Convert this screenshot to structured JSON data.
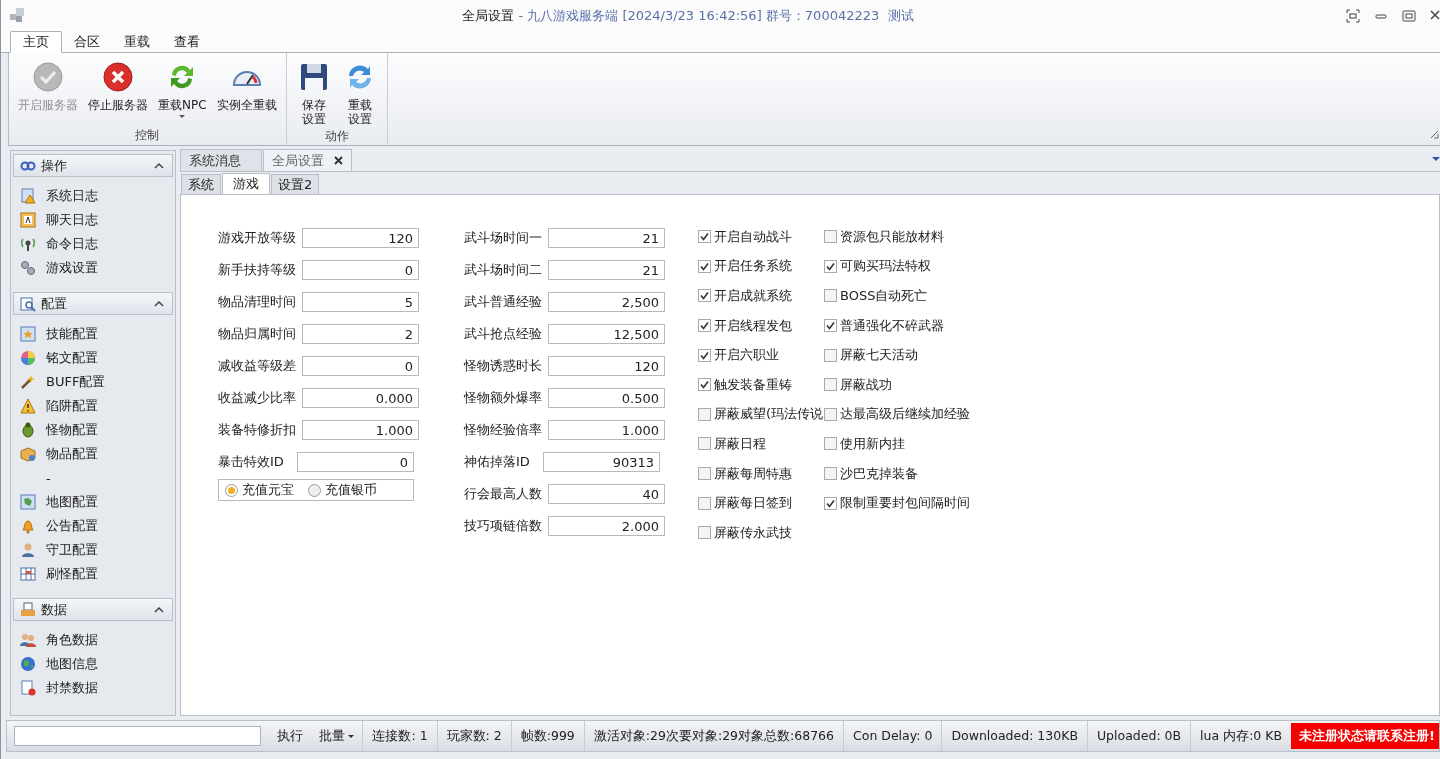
{
  "window": {
    "title": "全局设置",
    "subtitle": "- 九八游戏服务端 [2024/3/23 16:42:56] 群号：700042223  测试"
  },
  "ribbon": {
    "tabs": [
      {
        "label": "主页",
        "selected": true
      },
      {
        "label": "合区",
        "selected": false
      },
      {
        "label": "重载",
        "selected": false
      },
      {
        "label": "查看",
        "selected": false
      }
    ],
    "groups": [
      {
        "label": "控制",
        "buttons": [
          {
            "label": "开启服务器",
            "disabled": true,
            "dropdown": false
          },
          {
            "label": "停止服务器",
            "disabled": false,
            "dropdown": false
          },
          {
            "label": "重载NPC",
            "disabled": false,
            "dropdown": true
          },
          {
            "label": "实例全重载",
            "disabled": false,
            "dropdown": false
          }
        ]
      },
      {
        "label": "动作",
        "buttons": [
          {
            "label": "保存设置",
            "disabled": false,
            "dropdown": false
          },
          {
            "label": "重载设置",
            "disabled": false,
            "dropdown": false
          }
        ]
      }
    ]
  },
  "sidebar": {
    "sections": [
      {
        "title": "操作",
        "expanded": true,
        "items": [
          {
            "label": "系统日志",
            "kind": "item"
          },
          {
            "label": "聊天日志",
            "kind": "item"
          },
          {
            "label": "命令日志",
            "kind": "item"
          },
          {
            "label": "游戏设置",
            "kind": "item"
          }
        ]
      },
      {
        "title": "配置",
        "expanded": true,
        "items": [
          {
            "label": "技能配置",
            "kind": "item"
          },
          {
            "label": "铭文配置",
            "kind": "item"
          },
          {
            "label": "BUFF配置",
            "kind": "item"
          },
          {
            "label": "陷阱配置",
            "kind": "item"
          },
          {
            "label": "怪物配置",
            "kind": "item"
          },
          {
            "label": "物品配置",
            "kind": "item"
          },
          {
            "label": "-",
            "kind": "separator"
          },
          {
            "label": "地图配置",
            "kind": "item"
          },
          {
            "label": "公告配置",
            "kind": "item"
          },
          {
            "label": "守卫配置",
            "kind": "item"
          },
          {
            "label": "刷怪配置",
            "kind": "item"
          }
        ]
      },
      {
        "title": "数据",
        "expanded": true,
        "items": [
          {
            "label": "角色数据",
            "kind": "item"
          },
          {
            "label": "地图信息",
            "kind": "item"
          },
          {
            "label": "封禁数据",
            "kind": "item"
          }
        ]
      }
    ]
  },
  "doc_tabs": [
    {
      "label": "系统消息",
      "selected": false,
      "closable": false
    },
    {
      "label": "全局设置",
      "selected": true,
      "closable": true
    }
  ],
  "sub_tabs": [
    {
      "label": "系统",
      "selected": false
    },
    {
      "label": "游戏",
      "selected": true
    },
    {
      "label": "设置2",
      "selected": false
    }
  ],
  "form": {
    "fields_left": [
      {
        "label": "游戏开放等级",
        "value": "120"
      },
      {
        "label": "新手扶持等级",
        "value": "0"
      },
      {
        "label": "物品清理时间",
        "value": "5"
      },
      {
        "label": "物品归属时间",
        "value": "2"
      },
      {
        "label": "减收益等级差",
        "value": "0"
      },
      {
        "label": "收益减少比率",
        "value": "0.000"
      },
      {
        "label": "装备特修折扣",
        "value": "1.000"
      },
      {
        "label": "暴击特效ID",
        "value": "0"
      }
    ],
    "radios": [
      {
        "label": "充值元宝",
        "selected": true
      },
      {
        "label": "充值银币",
        "selected": false
      }
    ],
    "fields_right": [
      {
        "label": "武斗场时间一",
        "value": "21"
      },
      {
        "label": "武斗场时间二",
        "value": "21"
      },
      {
        "label": "武斗普通经验",
        "value": "2,500"
      },
      {
        "label": "武斗抢点经验",
        "value": "12,500"
      },
      {
        "label": "怪物诱惑时长",
        "value": "120"
      },
      {
        "label": "怪物额外爆率",
        "value": "0.500"
      },
      {
        "label": "怪物经验倍率",
        "value": "1.000"
      },
      {
        "label": "神佑掉落ID",
        "value": "90313"
      },
      {
        "label": "行会最高人数",
        "value": "40"
      },
      {
        "label": "技巧项链倍数",
        "value": "2.000"
      }
    ],
    "checkboxes_1": [
      {
        "label": "开启自动战斗",
        "checked": true
      },
      {
        "label": "开启任务系统",
        "checked": true
      },
      {
        "label": "开启成就系统",
        "checked": true
      },
      {
        "label": "开启线程发包",
        "checked": true
      },
      {
        "label": "开启六职业",
        "checked": true
      },
      {
        "label": "触发装备重铸",
        "checked": true
      },
      {
        "label": "屏蔽威望(玛法传说",
        "checked": false
      },
      {
        "label": "屏蔽日程",
        "checked": false
      },
      {
        "label": "屏蔽每周特惠",
        "checked": false
      },
      {
        "label": "屏蔽每日签到",
        "checked": false
      },
      {
        "label": "屏蔽传永武技",
        "checked": false
      }
    ],
    "checkboxes_2": [
      {
        "label": "资源包只能放材料",
        "checked": false
      },
      {
        "label": "可购买玛法特权",
        "checked": true
      },
      {
        "label": "BOSS自动死亡",
        "checked": false
      },
      {
        "label": "普通强化不碎武器",
        "checked": true
      },
      {
        "label": "屏蔽七天活动",
        "checked": false
      },
      {
        "label": "屏蔽战功",
        "checked": false
      },
      {
        "label": "达最高级后继续加经验",
        "checked": false
      },
      {
        "label": "使用新内挂",
        "checked": false
      },
      {
        "label": "沙巴克掉装备",
        "checked": false
      },
      {
        "label": "限制重要封包间隔时间",
        "checked": true
      }
    ]
  },
  "status_bar": {
    "items": [
      {
        "label": "执行",
        "kind": "button"
      },
      {
        "label": "批量",
        "kind": "dropdown"
      },
      {
        "label": "连接数: 1",
        "kind": "text"
      },
      {
        "label": "玩家数: 2",
        "kind": "text"
      },
      {
        "label": "帧数:999",
        "kind": "text"
      },
      {
        "label": "激活对象:29次要对象:29对象总数:68766",
        "kind": "text"
      },
      {
        "label": "Con Delay: 0",
        "kind": "text"
      },
      {
        "label": "Downloaded: 130KB",
        "kind": "text"
      },
      {
        "label": "Uploaded: 0B",
        "kind": "text"
      },
      {
        "label": "lua 内存:0 KB",
        "kind": "text"
      },
      {
        "label": "未注册状态请联系注册!",
        "kind": "alert"
      }
    ]
  }
}
